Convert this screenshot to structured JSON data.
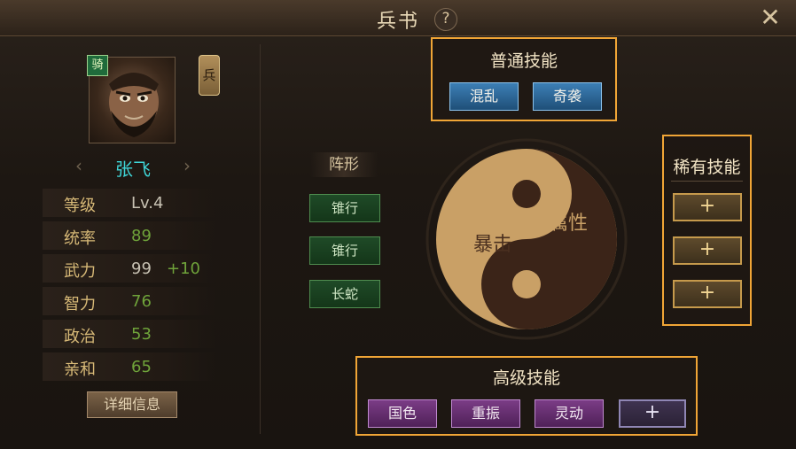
{
  "window": {
    "title": "兵书",
    "help_symbol": "?",
    "close_symbol": "✕"
  },
  "hero": {
    "class_badge": "骑",
    "troop_tag": "兵",
    "name": "张飞",
    "prev_arrow": "‹",
    "next_arrow": "›",
    "stats": [
      {
        "label": "等级",
        "value": "Lv.4",
        "bonus": ""
      },
      {
        "label": "统率",
        "value": "89",
        "bonus": ""
      },
      {
        "label": "武力",
        "value": "99",
        "bonus": "+10"
      },
      {
        "label": "智力",
        "value": "76",
        "bonus": ""
      },
      {
        "label": "政治",
        "value": "53",
        "bonus": ""
      },
      {
        "label": "亲和",
        "value": "65",
        "bonus": ""
      }
    ],
    "detail_button": "详细信息"
  },
  "formation": {
    "title": "阵形",
    "items": [
      "锥行",
      "锥行",
      "长蛇"
    ]
  },
  "taiji": {
    "left_text": "暴击",
    "right_text": "属性"
  },
  "normal_skills": {
    "title": "普通技能",
    "items": [
      "混乱",
      "奇袭"
    ]
  },
  "rare_skills": {
    "title": "稀有技能",
    "slots": [
      "+",
      "+",
      "+"
    ]
  },
  "advanced_skills": {
    "title": "高级技能",
    "items": [
      "国色",
      "重振",
      "灵动"
    ],
    "add_slot": "+"
  },
  "colors": {
    "highlight_border": "#f0a536",
    "name_cyan": "#3fd6d8",
    "stat_label_gold": "#d7b977",
    "stat_value_green": "#6fa33a"
  }
}
